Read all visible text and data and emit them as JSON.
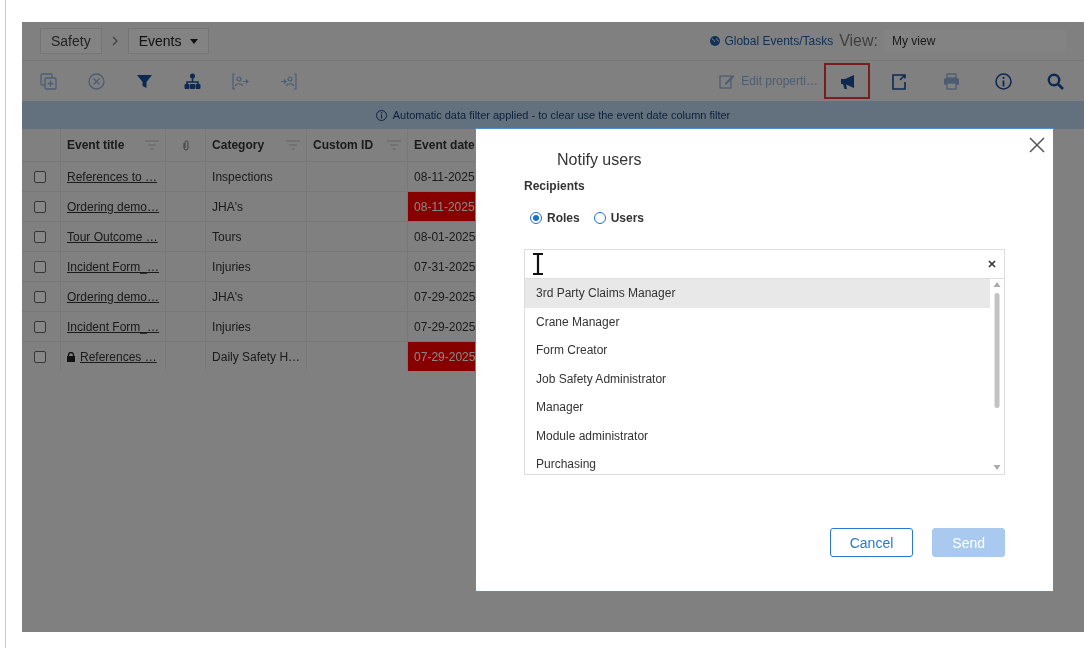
{
  "breadcrumb": {
    "root": "Safety",
    "current": "Events"
  },
  "header": {
    "global_link": "Global Events/Tasks",
    "view_label": "View:",
    "view_value": "My view"
  },
  "toolbar": {
    "left_icons": [
      {
        "disabled": true
      },
      {
        "disabled": true
      },
      {
        "disabled": false
      },
      {
        "disabled": false
      },
      {
        "disabled": true
      },
      {
        "disabled": true
      }
    ],
    "edit_properties": {
      "label": "Edit properti…",
      "disabled": true
    },
    "right_icons": [
      {
        "selected": true,
        "disabled": false
      },
      {
        "selected": false,
        "disabled": false
      },
      {
        "selected": false,
        "disabled": true
      },
      {
        "selected": false,
        "disabled": false
      },
      {
        "selected": false,
        "disabled": false
      }
    ]
  },
  "banner": "Automatic data filter applied - to clear use the event date column filter",
  "table": {
    "columns": [
      {
        "kind": "text",
        "label": "Event title",
        "filter": true
      },
      {
        "kind": "attachment",
        "filter": false
      },
      {
        "kind": "text",
        "label": "Category",
        "filter": true
      },
      {
        "kind": "text",
        "label": "Custom ID",
        "filter": true
      },
      {
        "kind": "text",
        "label": "Event date",
        "filter": false
      }
    ],
    "rows": [
      {
        "checked": false,
        "title": "References to …",
        "locked": false,
        "category": "Inspections",
        "date": "08-11-2025",
        "overdue": false
      },
      {
        "checked": false,
        "title": "Ordering demo…",
        "locked": false,
        "category": "JHA's",
        "date": "08-11-2025",
        "overdue": true
      },
      {
        "checked": false,
        "title": "Tour Outcome …",
        "locked": false,
        "category": "Tours",
        "date": "08-01-2025",
        "overdue": false
      },
      {
        "checked": false,
        "title": "Incident Form_…",
        "locked": false,
        "category": "Injuries",
        "date": "07-31-2025",
        "overdue": false
      },
      {
        "checked": false,
        "title": "Ordering demo…",
        "locked": false,
        "category": "JHA's",
        "date": "07-29-2025",
        "overdue": false
      },
      {
        "checked": false,
        "title": "Incident Form_…",
        "locked": false,
        "category": "Injuries",
        "date": "07-29-2025",
        "overdue": false
      },
      {
        "checked": false,
        "title": "References …",
        "locked": true,
        "category": "Daily Safety H…",
        "date": "07-29-2025",
        "overdue": true
      }
    ]
  },
  "dialog": {
    "title": "Notify users",
    "recipients_label": "Recipients",
    "radios": [
      {
        "label": "Roles",
        "selected": true
      },
      {
        "label": "Users",
        "selected": false
      }
    ],
    "options": [
      {
        "label": "3rd Party Claims Manager",
        "highlighted": true
      },
      {
        "label": "Crane Manager",
        "highlighted": false
      },
      {
        "label": "Form Creator",
        "highlighted": false
      },
      {
        "label": "Job Safety Administrator",
        "highlighted": false
      },
      {
        "label": "Manager",
        "highlighted": false
      },
      {
        "label": "Module administrator",
        "highlighted": false
      },
      {
        "label": "Purchasing",
        "highlighted": false
      }
    ],
    "buttons": [
      {
        "kind": "secondary",
        "label": "Cancel",
        "disabled": false
      },
      {
        "kind": "primary",
        "label": "Send",
        "disabled": true
      }
    ]
  }
}
